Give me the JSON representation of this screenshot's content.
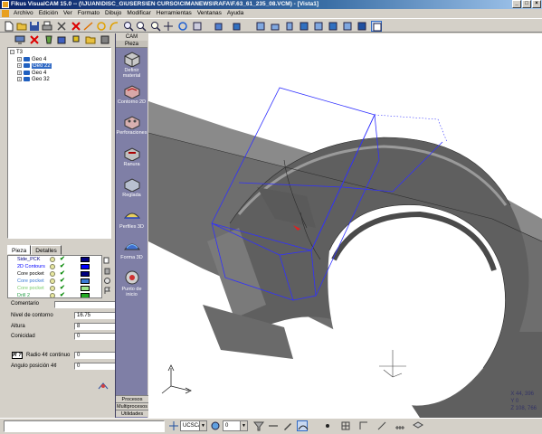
{
  "window": {
    "title": "Fikus VisualCAM 15.0 -- (\\\\JUAN\\DISC_G\\USERS\\EN CURSO\\CIMANEWS\\RAFA\\F.63_61_235_08.VCM) - [Vista1]"
  },
  "menu": [
    "Archivo",
    "Edición",
    "Ver",
    "Formato",
    "Dibujo",
    "Modificar",
    "Herramientas",
    "Ventanas",
    "Ayuda"
  ],
  "tree": {
    "root": "T3",
    "items": [
      {
        "label": "Geo 4",
        "selected": false
      },
      {
        "label": "Geo 22",
        "selected": true
      },
      {
        "label": "Geo 4",
        "selected": false
      },
      {
        "label": "Geo 32",
        "selected": false
      }
    ]
  },
  "tabs": [
    "Pieza",
    "Detalles"
  ],
  "operations": [
    {
      "label": "Side_PCK",
      "color": "#000080",
      "text_color": "#000080"
    },
    {
      "label": "2D Contours",
      "color": "#0000ff",
      "text_color": "#0000ff"
    },
    {
      "label": "Core pocket",
      "color": "#000080",
      "text_color": "#000000"
    },
    {
      "label": "Core pocket",
      "color": "#3a7ad5",
      "text_color": "#3a7ad5"
    },
    {
      "label": "Core pocket",
      "color": "#9be58a",
      "text_color": "#7acc6a"
    },
    {
      "label": "Drill 2",
      "color": "#22aa22",
      "text_color": "#2aa04a"
    }
  ],
  "properties": {
    "comentario": {
      "label": "Comentario",
      "value": ""
    },
    "nivel": {
      "label": "Nivel de contorno",
      "value": "16.75"
    },
    "altura": {
      "label": "Altura",
      "value": "8"
    },
    "conicidad": {
      "label": "Conicidad",
      "value": "0"
    },
    "r_badge": "R ?",
    "radio": {
      "label": "Radio 4¢ continuo",
      "value": "0"
    },
    "angulo": {
      "label": "Angulo posición 4¢",
      "value": "0"
    }
  },
  "cam": {
    "header": "CAM",
    "section": "Pieza",
    "items": [
      "Definir material",
      "Contorno 2D",
      "Perforaciones",
      "Ranura",
      "Reglada",
      "Perfiles 3D",
      "Forma 3D",
      "Punto de inicio"
    ],
    "bottom": [
      "Procesos",
      "Multiprocesos",
      "Utilidades"
    ]
  },
  "coords": {
    "x": "X  44, 396",
    "y": "Y  0",
    "z": "Z  108, 766"
  },
  "status": {
    "ucs": "UCSCAM",
    "layer": "0"
  },
  "colors": {
    "title_start": "#0a246a",
    "cam_strip": "#7f7fa6",
    "model_gray": "#6e6e6e",
    "toolpath_blue": "#3030ff"
  }
}
